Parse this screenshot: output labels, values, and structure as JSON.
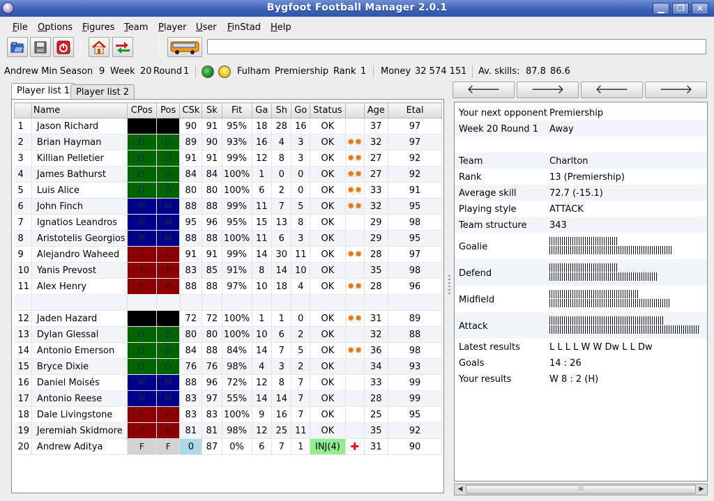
{
  "window": {
    "title": "Bygfoot Football Manager 2.0.1"
  },
  "menu": [
    "File",
    "Options",
    "Figures",
    "Team",
    "Player",
    "User",
    "FinStad",
    "Help"
  ],
  "menu_underline": [
    "F",
    "O",
    "F",
    "T",
    "P",
    "U",
    "F",
    "H"
  ],
  "toolbar": {
    "icons": [
      "open-folder-icon",
      "save-disk-icon",
      "quit-icon",
      "home-icon",
      "transfer-icon",
      "bus-icon"
    ],
    "search_value": ""
  },
  "info": {
    "user": "Andrew Min",
    "season_label": "Season",
    "season": "9",
    "week_label": "Week",
    "week": "20",
    "round_label": "Round",
    "round": "1",
    "team": "Fulham",
    "league": "Premiership",
    "rank_label": "Rank",
    "rank": "1",
    "money_label": "Money",
    "money": "32 574 151",
    "avskills_label": "Av. skills:",
    "avskill1": "87.8",
    "avskill2": "86.6"
  },
  "tabs": [
    "Player list 1",
    "Player list 2"
  ],
  "columns": [
    "",
    "Name",
    "CPos",
    "Pos",
    "CSk",
    "Sk",
    "Fit",
    "Ga",
    "Sh",
    "Go",
    "Status",
    "",
    "Age",
    "Etal"
  ],
  "players": [
    {
      "num": "1",
      "name": "Jason Richard",
      "cpos": "G",
      "pos": "G",
      "csk": "90",
      "sk": "91",
      "fit": "95%",
      "ga": "18",
      "sh": "28",
      "go": "16",
      "status": "OK",
      "flame": false,
      "age": "37",
      "etal": "97"
    },
    {
      "num": "2",
      "name": "Brian Hayman",
      "cpos": "D",
      "pos": "D",
      "csk": "89",
      "sk": "90",
      "fit": "93%",
      "ga": "16",
      "sh": "4",
      "go": "3",
      "status": "OK",
      "flame": true,
      "age": "32",
      "etal": "97"
    },
    {
      "num": "3",
      "name": "Killian Pelletier",
      "cpos": "D",
      "pos": "D",
      "csk": "91",
      "sk": "91",
      "fit": "99%",
      "ga": "12",
      "sh": "8",
      "go": "3",
      "status": "OK",
      "flame": true,
      "age": "27",
      "etal": "92"
    },
    {
      "num": "4",
      "name": "James Bathurst",
      "cpos": "D",
      "pos": "D",
      "csk": "84",
      "sk": "84",
      "fit": "100%",
      "ga": "1",
      "sh": "0",
      "go": "0",
      "status": "OK",
      "flame": true,
      "age": "27",
      "etal": "92"
    },
    {
      "num": "5",
      "name": "Luis Alice",
      "cpos": "D",
      "pos": "D",
      "csk": "80",
      "sk": "80",
      "fit": "100%",
      "ga": "6",
      "sh": "2",
      "go": "0",
      "status": "OK",
      "flame": true,
      "age": "33",
      "etal": "91"
    },
    {
      "num": "6",
      "name": "John Finch",
      "cpos": "M",
      "pos": "M",
      "csk": "88",
      "sk": "88",
      "fit": "99%",
      "ga": "11",
      "sh": "7",
      "go": "5",
      "status": "OK",
      "flame": true,
      "age": "32",
      "etal": "95"
    },
    {
      "num": "7",
      "name": "Ignatios Leandros",
      "cpos": "M",
      "pos": "M",
      "csk": "95",
      "sk": "96",
      "fit": "95%",
      "ga": "15",
      "sh": "13",
      "go": "8",
      "status": "OK",
      "flame": false,
      "age": "29",
      "etal": "98"
    },
    {
      "num": "8",
      "name": "Aristotelis Georgios",
      "cpos": "M",
      "pos": "M",
      "csk": "88",
      "sk": "88",
      "fit": "100%",
      "ga": "11",
      "sh": "6",
      "go": "3",
      "status": "OK",
      "flame": false,
      "age": "29",
      "etal": "95"
    },
    {
      "num": "9",
      "name": "Alejandro Waheed",
      "cpos": "F",
      "pos": "F",
      "csk": "91",
      "sk": "91",
      "fit": "99%",
      "ga": "14",
      "sh": "30",
      "go": "11",
      "status": "OK",
      "flame": true,
      "age": "28",
      "etal": "97"
    },
    {
      "num": "10",
      "name": "Yanis Prevost",
      "cpos": "F",
      "pos": "F",
      "csk": "83",
      "sk": "85",
      "fit": "91%",
      "ga": "8",
      "sh": "14",
      "go": "10",
      "status": "OK",
      "flame": false,
      "age": "35",
      "etal": "98"
    },
    {
      "num": "11",
      "name": "Alex Henry",
      "cpos": "F",
      "pos": "F",
      "csk": "88",
      "sk": "88",
      "fit": "97%",
      "ga": "10",
      "sh": "18",
      "go": "4",
      "status": "OK",
      "flame": true,
      "age": "28",
      "etal": "96"
    },
    {
      "num": "",
      "name": "",
      "cpos": "",
      "pos": "",
      "csk": "",
      "sk": "",
      "fit": "",
      "ga": "",
      "sh": "",
      "go": "",
      "status": "",
      "flame": false,
      "age": "",
      "etal": "",
      "blank": true
    },
    {
      "num": "12",
      "name": "Jaden Hazard",
      "cpos": "G",
      "pos": "G",
      "csk": "72",
      "sk": "72",
      "fit": "100%",
      "ga": "1",
      "sh": "1",
      "go": "0",
      "status": "OK",
      "flame": true,
      "age": "31",
      "etal": "89"
    },
    {
      "num": "13",
      "name": "Dylan Glessal",
      "cpos": "D",
      "pos": "D",
      "csk": "80",
      "sk": "80",
      "fit": "100%",
      "ga": "10",
      "sh": "6",
      "go": "2",
      "status": "OK",
      "flame": false,
      "age": "32",
      "etal": "88"
    },
    {
      "num": "14",
      "name": "Antonio Emerson",
      "cpos": "D",
      "pos": "D",
      "csk": "84",
      "sk": "88",
      "fit": "84%",
      "ga": "14",
      "sh": "7",
      "go": "5",
      "status": "OK",
      "flame": true,
      "age": "36",
      "etal": "98"
    },
    {
      "num": "15",
      "name": "Bryce Dixie",
      "cpos": "D",
      "pos": "D",
      "csk": "76",
      "sk": "76",
      "fit": "98%",
      "ga": "4",
      "sh": "3",
      "go": "2",
      "status": "OK",
      "flame": false,
      "age": "34",
      "etal": "93"
    },
    {
      "num": "16",
      "name": "Daniel Moisés",
      "cpos": "M",
      "pos": "M",
      "csk": "88",
      "sk": "96",
      "fit": "72%",
      "ga": "12",
      "sh": "8",
      "go": "7",
      "status": "OK",
      "flame": false,
      "age": "33",
      "etal": "99"
    },
    {
      "num": "17",
      "name": "Antonio Reese",
      "cpos": "M",
      "pos": "M",
      "csk": "83",
      "sk": "97",
      "fit": "55%",
      "ga": "14",
      "sh": "14",
      "go": "7",
      "status": "OK",
      "flame": false,
      "age": "28",
      "etal": "99"
    },
    {
      "num": "18",
      "name": "Dale Livingstone",
      "cpos": "F",
      "pos": "F",
      "csk": "83",
      "sk": "83",
      "fit": "100%",
      "ga": "9",
      "sh": "16",
      "go": "7",
      "status": "OK",
      "flame": false,
      "age": "25",
      "etal": "95"
    },
    {
      "num": "19",
      "name": "Jeremiah Skidmore",
      "cpos": "F",
      "pos": "F",
      "csk": "81",
      "sk": "81",
      "fit": "98%",
      "ga": "12",
      "sh": "25",
      "go": "11",
      "status": "OK",
      "flame": false,
      "age": "35",
      "etal": "92"
    },
    {
      "num": "20",
      "name": "Andrew Aditya",
      "cpos": "F",
      "pos": "F",
      "csk": "0",
      "sk": "87",
      "fit": "0%",
      "ga": "6",
      "sh": "7",
      "go": "1",
      "status": "INJ(4)",
      "flame": false,
      "injured": true,
      "age": "31",
      "etal": "90"
    }
  ],
  "opponent": {
    "rows": [
      {
        "k": "Your next opponent",
        "v": "Premiership"
      },
      {
        "k": "Week 20 Round 1",
        "v": "Away"
      },
      {
        "k": "",
        "v": ""
      },
      {
        "k": "Team",
        "v": "Charlton"
      },
      {
        "k": "Rank",
        "v": "13 (Premiership)"
      },
      {
        "k": "Average skill",
        "v": "72.7 (-15.1)"
      },
      {
        "k": "Playing style",
        "v": "ATTACK"
      },
      {
        "k": "Team structure",
        "v": "343"
      }
    ],
    "bars": [
      {
        "k": "Goalie",
        "own": 0.27,
        "opp": 0.48
      },
      {
        "k": "Defend",
        "own": 0.27,
        "opp": 0.42
      },
      {
        "k": "Midfield",
        "own": 0.35,
        "opp": 0.47
      },
      {
        "k": "Attack",
        "own": 0.45,
        "opp": 0.59
      }
    ],
    "tail": [
      {
        "k": "Latest results",
        "v": "L  L  L  L  W  W  Dw L  L  Dw"
      },
      {
        "k": "Goals",
        "v": "14 : 26"
      },
      {
        "k": "Your results",
        "v": "W  8 : 2 (H)"
      }
    ]
  },
  "colors": {
    "goalie": "#000000",
    "defender": "#006400",
    "midfield": "#00008b",
    "forward": "#8b0000",
    "injured": "#90ee90",
    "low": "#add8e6"
  }
}
